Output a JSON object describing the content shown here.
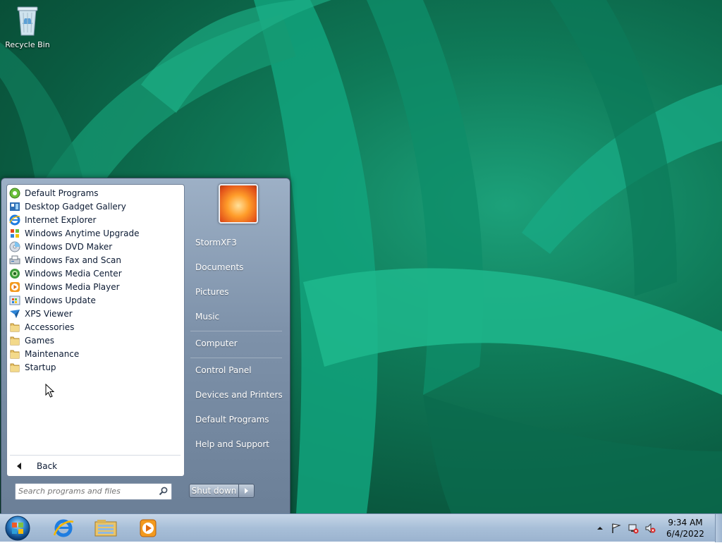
{
  "desktop": {
    "icons": [
      {
        "label": "Recycle Bin",
        "icon": "recycle-bin-icon"
      }
    ]
  },
  "start_menu": {
    "programs": [
      {
        "label": "Default Programs",
        "icon": "default-programs-icon"
      },
      {
        "label": "Desktop Gadget Gallery",
        "icon": "gadget-gallery-icon"
      },
      {
        "label": "Internet Explorer",
        "icon": "internet-explorer-icon"
      },
      {
        "label": "Windows Anytime Upgrade",
        "icon": "anytime-upgrade-icon"
      },
      {
        "label": "Windows DVD Maker",
        "icon": "dvd-maker-icon"
      },
      {
        "label": "Windows Fax and Scan",
        "icon": "fax-scan-icon"
      },
      {
        "label": "Windows Media Center",
        "icon": "media-center-icon"
      },
      {
        "label": "Windows Media Player",
        "icon": "media-player-icon"
      },
      {
        "label": "Windows Update",
        "icon": "windows-update-icon"
      },
      {
        "label": "XPS Viewer",
        "icon": "xps-viewer-icon"
      },
      {
        "label": "Accessories",
        "icon": "folder-icon"
      },
      {
        "label": "Games",
        "icon": "folder-icon"
      },
      {
        "label": "Maintenance",
        "icon": "folder-icon"
      },
      {
        "label": "Startup",
        "icon": "folder-icon"
      }
    ],
    "back_label": "Back",
    "search_placeholder": "Search programs and files",
    "right_items": [
      {
        "label": "StormXF3"
      },
      {
        "label": "Documents"
      },
      {
        "label": "Pictures"
      },
      {
        "label": "Music"
      },
      {
        "label": "Computer"
      },
      {
        "label": "Control Panel"
      },
      {
        "label": "Devices and Printers"
      },
      {
        "label": "Default Programs"
      },
      {
        "label": "Help and Support"
      }
    ],
    "shutdown_label": "Shut down"
  },
  "taskbar": {
    "pinned": [
      {
        "name": "internet-explorer",
        "icon": "internet-explorer-icon"
      },
      {
        "name": "windows-explorer",
        "icon": "folder-library-icon"
      },
      {
        "name": "media-player",
        "icon": "media-player-icon"
      }
    ],
    "tray_icons": [
      "show-hidden-icons-icon",
      "action-center-flag-icon",
      "network-icon",
      "volume-muted-icon"
    ],
    "time": "9:34 AM",
    "date": "6/4/2022"
  },
  "colors": {
    "accent": "#1ca17a",
    "start_menu": "#7e92aa",
    "taskbar": "#a8bfd8"
  }
}
